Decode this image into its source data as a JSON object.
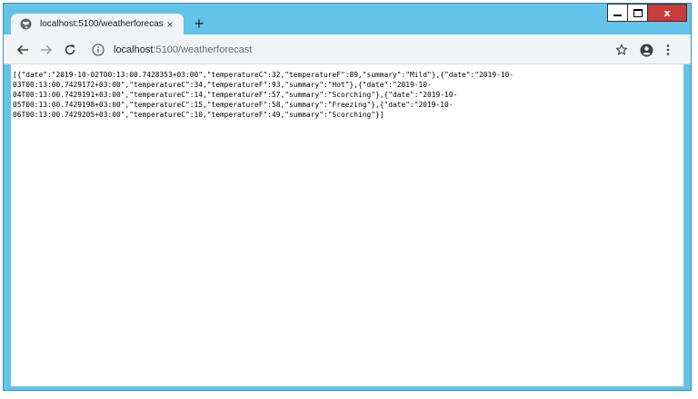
{
  "tab": {
    "title": "localhost:5100/weatherforecast",
    "close_symbol": "×",
    "favicon_icon": "globe-icon"
  },
  "new_tab_symbol": "+",
  "window_controls": {
    "close_symbol": "x"
  },
  "address_bar": {
    "host": "localhost",
    "path": ":5100/weatherforecast"
  },
  "page": {
    "body_lines": [
      "[{\"date\":\"2019-10-02T00:13:00.7428353+03:00\",\"temperatureC\":32,\"temperatureF\":89,\"summary\":\"Mild\"},{\"date\":\"2019-10-",
      "03T00:13:00.7429172+03:00\",\"temperatureC\":34,\"temperatureF\":93,\"summary\":\"Hot\"},{\"date\":\"2019-10-",
      "04T00:13:00.7429191+03:00\",\"temperatureC\":14,\"temperatureF\":57,\"summary\":\"Scorching\"},{\"date\":\"2019-10-",
      "05T00:13:00.7429198+03:00\",\"temperatureC\":15,\"temperatureF\":58,\"summary\":\"Freezing\"},{\"date\":\"2019-10-",
      "06T00:13:00.7429205+03:00\",\"temperatureC\":10,\"temperatureF\":49,\"summary\":\"Scorching\"}]"
    ]
  },
  "colors": {
    "frame": "#64c3e8",
    "toolbar": "#f1f3f4",
    "close_button": "#c83c3c"
  }
}
